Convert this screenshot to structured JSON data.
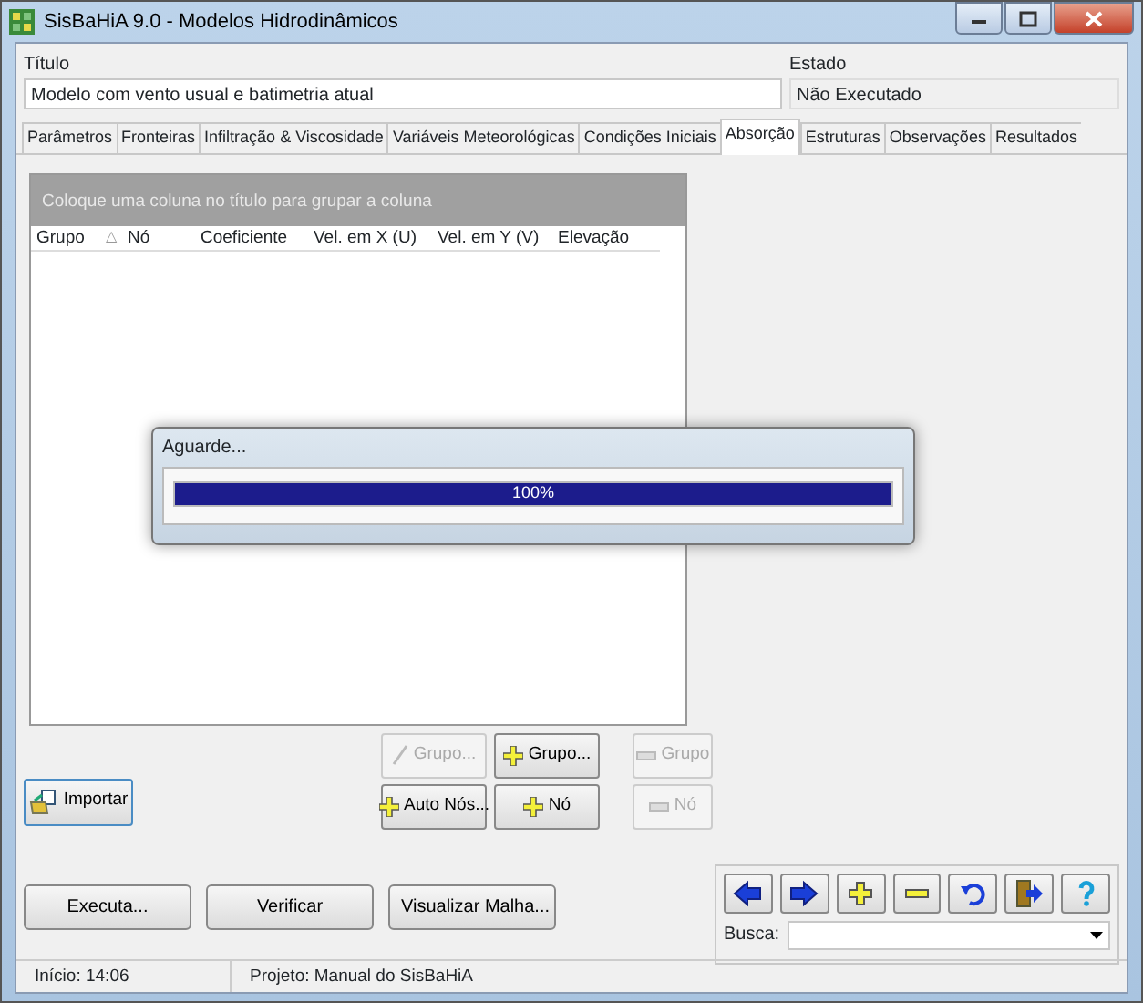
{
  "window": {
    "title": "SisBaHiA 9.0 - Modelos Hidrodinâmicos"
  },
  "header": {
    "title_label": "Título",
    "title_value": "Modelo com vento usual e batimetria atual",
    "state_label": "Estado",
    "state_value": "Não Executado"
  },
  "tabs": [
    {
      "label": "Parâmetros",
      "selected": false
    },
    {
      "label": "Fronteiras",
      "selected": false
    },
    {
      "label": "Infiltração & Viscosidade",
      "selected": false
    },
    {
      "label": "Variáveis Meteorológicas",
      "selected": false
    },
    {
      "label": "Condições Iniciais",
      "selected": false
    },
    {
      "label": "Absorção",
      "selected": true
    },
    {
      "label": "Estruturas",
      "selected": false
    },
    {
      "label": "Observações",
      "selected": false
    },
    {
      "label": "Resultados",
      "selected": false
    }
  ],
  "grid": {
    "group_hint": "Coloque uma coluna no título para grupar a coluna",
    "columns": [
      {
        "label": "Grupo",
        "sort": "△"
      },
      {
        "label": "Nó"
      },
      {
        "label": "Coeficiente"
      },
      {
        "label": "Vel. em X (U)"
      },
      {
        "label": "Vel. em Y (V)"
      },
      {
        "label": "Elevação"
      }
    ]
  },
  "import_button": {
    "label": "Importar"
  },
  "grid_buttons": [
    {
      "label": "Grupo...",
      "kind": "edit",
      "disabled": true
    },
    {
      "label": "Grupo...",
      "kind": "add",
      "disabled": false
    },
    {
      "label": "Grupo",
      "kind": "remove",
      "disabled": true
    },
    {
      "label": "Auto Nós...",
      "kind": "add",
      "disabled": false
    },
    {
      "label": "Nó",
      "kind": "add",
      "disabled": false
    },
    {
      "label": "Nó",
      "kind": "remove",
      "disabled": true
    }
  ],
  "progress_dialog": {
    "title": "Aguarde...",
    "level": 1.0,
    "reading": "100%"
  },
  "actions": [
    "Executa...",
    "Verificar",
    "Visualizar Malha..."
  ],
  "navigator": {
    "buttons": [
      {
        "kind": "left"
      },
      {
        "kind": "right"
      },
      {
        "kind": "add"
      },
      {
        "kind": "remove"
      },
      {
        "kind": "undo"
      },
      {
        "kind": "exit"
      },
      {
        "kind": "help"
      }
    ],
    "search_label": "Busca:"
  },
  "status_bar": [
    "Início: 14:06",
    "Projeto: Manual do SisBaHiA"
  ]
}
